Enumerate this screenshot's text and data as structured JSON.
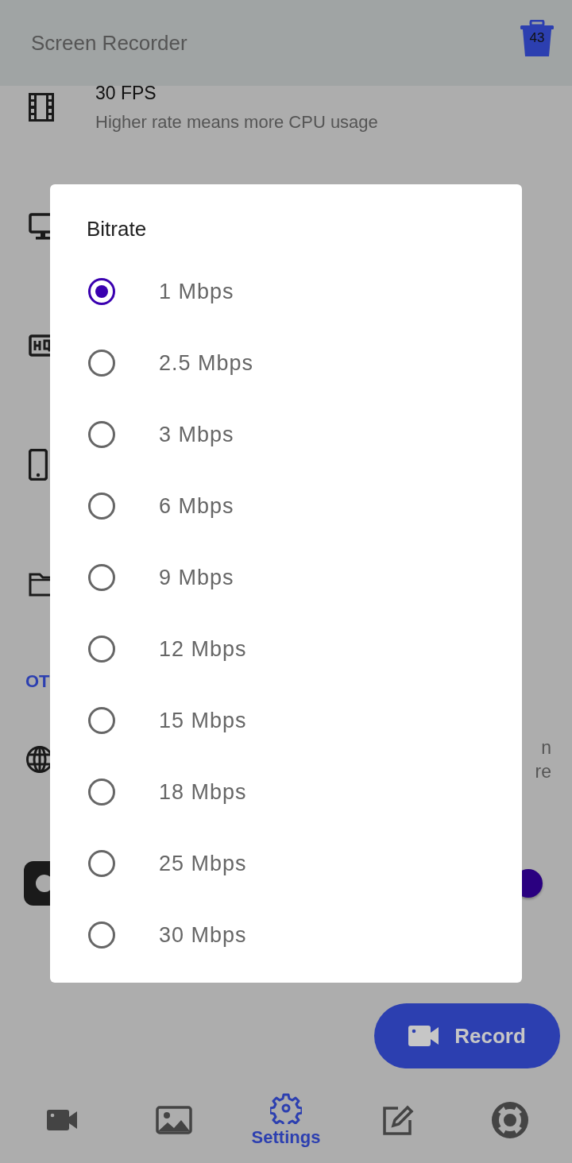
{
  "app_bar": {
    "title": "Screen Recorder",
    "trash_count": "43"
  },
  "settings_rows": [
    {
      "kind": "film",
      "title": "30 FPS",
      "subtitle": "Higher rate means more CPU usage"
    },
    {
      "kind": "monitor"
    },
    {
      "kind": "hq"
    },
    {
      "kind": "phone"
    },
    {
      "kind": "folder"
    }
  ],
  "section_header": "OT",
  "globe_row": {
    "kind": "globe",
    "fragments": [
      "n",
      "re"
    ]
  },
  "toggle_row": {
    "kind": "dark-app",
    "on": true
  },
  "dialog": {
    "title": "Bitrate",
    "options": [
      {
        "label": "1 Mbps",
        "selected": true
      },
      {
        "label": "2.5 Mbps",
        "selected": false
      },
      {
        "label": "3 Mbps",
        "selected": false
      },
      {
        "label": "6 Mbps",
        "selected": false
      },
      {
        "label": "9 Mbps",
        "selected": false
      },
      {
        "label": "12 Mbps",
        "selected": false
      },
      {
        "label": "15 Mbps",
        "selected": false
      },
      {
        "label": "18 Mbps",
        "selected": false
      },
      {
        "label": "25 Mbps",
        "selected": false
      },
      {
        "label": "30 Mbps",
        "selected": false
      }
    ]
  },
  "record_button": {
    "label": "Record"
  },
  "bottom_nav": [
    {
      "kind": "video",
      "selected": false
    },
    {
      "kind": "image",
      "selected": false
    },
    {
      "kind": "settings",
      "label": "Settings",
      "selected": true
    },
    {
      "kind": "edit",
      "selected": false
    },
    {
      "kind": "help",
      "selected": false
    }
  ]
}
